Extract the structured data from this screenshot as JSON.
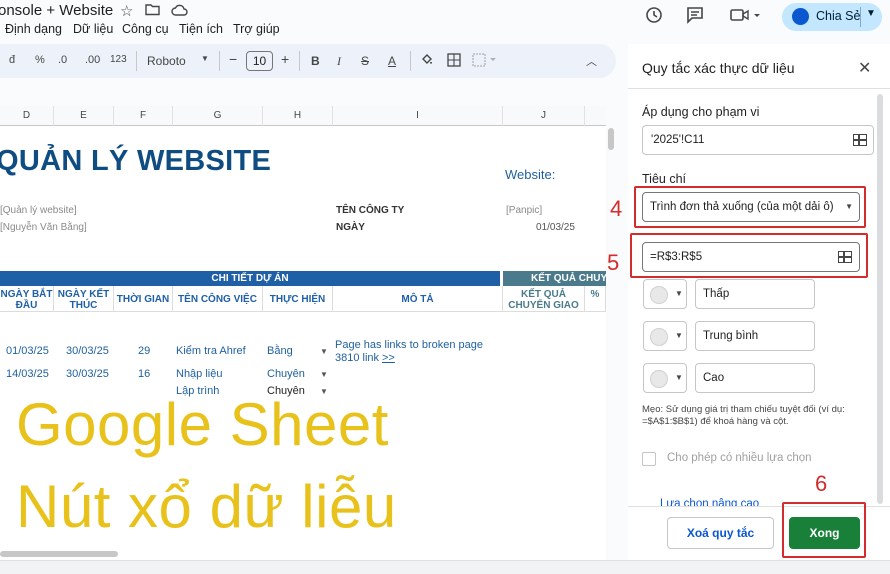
{
  "app": {
    "doc_title": "onsole + Website",
    "menus": [
      "Định dạng",
      "Dữ liệu",
      "Công cụ",
      "Tiện ích",
      "Trợ giúp"
    ],
    "share_label": "Chia Sẻ"
  },
  "toolbar": {
    "items": [
      "đ",
      "%",
      ".0",
      ".00",
      "123"
    ],
    "font": "Roboto",
    "font_size": "10"
  },
  "sheet": {
    "columns": [
      "D",
      "E",
      "F",
      "G",
      "H",
      "I",
      "J"
    ],
    "title": "QUẢN LÝ WEBSITE",
    "website_label": "Website:",
    "meta": {
      "project_placeholder": "[Quản lý website]",
      "owner_placeholder": "[Nguyễn Văn Bằng]",
      "company_label": "TÊN CÔNG TY",
      "date_label": "NGÀY",
      "company_value": "[Panpic]",
      "date_value": "01/03/25"
    },
    "band_detail": "CHI TIẾT DỰ ÁN",
    "band_result": "KẾT QUẢ CHUYỂ",
    "headers": {
      "start": "NGÀY BẮT ĐẦU",
      "end": "NGÀY KẾT THÚC",
      "time": "THỜI GIAN",
      "task": "TÊN CÔNG VIỆC",
      "assignee": "THỰC HIỆN",
      "desc": "MÔ TẢ",
      "result": "KẾT QUẢ CHUYỂN GIAO",
      "pct": "%"
    },
    "rows": [
      {
        "start": "01/03/25",
        "end": "30/03/25",
        "time": "29",
        "task": "Kiểm tra Ahref",
        "assignee": "Bằng",
        "desc": "Page has links to broken page",
        "desc2": "3810 link",
        "link": ">>"
      },
      {
        "start": "14/03/25",
        "end": "30/03/25",
        "time": "16",
        "task": "Nhập liệu",
        "assignee": "Chuyên"
      },
      {
        "task": "Lập trình",
        "assignee": "Chuyên"
      }
    ],
    "overlay_line1": "Google Sheet",
    "overlay_line2": "Nút xổ dữ liễu"
  },
  "panel": {
    "title": "Quy tắc xác thực dữ liệu",
    "apply_label": "Áp dụng cho phạm vi",
    "range_value": "'2025'!C11",
    "criteria_label": "Tiêu chí",
    "criteria_value": "Trình đơn thả xuống (của một dải ô)",
    "formula_value": "=R$3:R$5",
    "options": [
      "Thấp",
      "Trung bình",
      "Cao"
    ],
    "tip": "Mẹo: Sử dụng giá trị tham chiếu tuyệt đối (ví dụ: =$A$1:$B$1) để khoá hàng và cột.",
    "multi_select_label": "Cho phép có nhiều lựa chọn",
    "advanced_label": "Lựa chọn nâng cao",
    "delete_label": "Xoá quy tắc",
    "done_label": "Xong"
  },
  "annotations": {
    "n4": "4",
    "n5": "5",
    "n6": "6",
    "color": "#d22c2c"
  },
  "colors": {
    "accent": "#0b57d0",
    "done_green": "#188038",
    "header_blue": "#1f5fa6",
    "overlay_yellow": "#e8c21a"
  }
}
